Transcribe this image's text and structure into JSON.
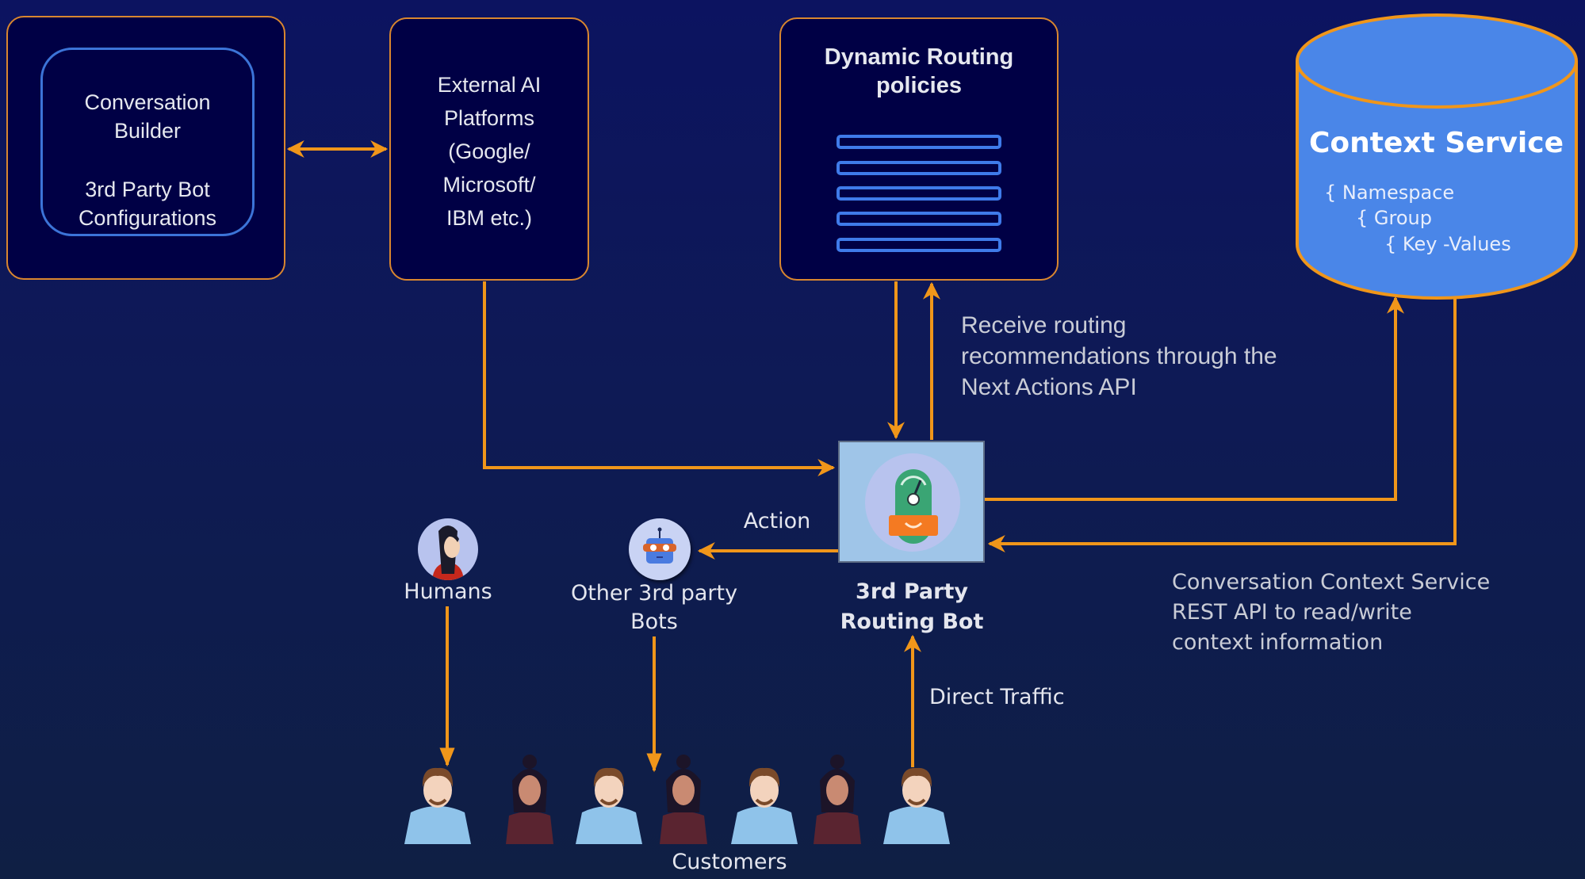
{
  "colors": {
    "background_top": "#0c1360",
    "background_bottom": "#0f1f44",
    "box_fill": "#000045",
    "box_border": "#d9862f",
    "arrow": "#f0961a",
    "accent_blue": "#3f7bea",
    "cylinder_fill": "#4a86e8",
    "routing_bot_fill": "#9fc5e8"
  },
  "boxes": {
    "conversation_builder": {
      "title_lines": [
        "Conversation",
        "Builder"
      ],
      "subtitle_lines": [
        "3rd Party Bot",
        "Configurations"
      ]
    },
    "external_ai": {
      "lines": [
        "External AI",
        "Platforms",
        "(Google/",
        "Microsoft/",
        "IBM etc.)"
      ]
    },
    "dynamic_routing": {
      "title_lines": [
        "Dynamic Routing",
        "policies"
      ],
      "policy_rows": 5
    },
    "context_service": {
      "title": "Context Service",
      "hierarchy": [
        "{ Namespace",
        "{ Group",
        "{ Key -Values"
      ]
    }
  },
  "nodes": {
    "routing_bot": {
      "label_lines": [
        "3rd Party",
        "Routing Bot"
      ],
      "icon": "routing-bot-icon"
    },
    "humans": {
      "label": "Humans",
      "icon": "human-agent-avatar-icon"
    },
    "other_bots": {
      "label_lines": [
        "Other 3rd party",
        "Bots"
      ],
      "icon": "robot-avatar-icon"
    },
    "customers": {
      "label": "Customers",
      "figures": [
        "man",
        "woman",
        "man",
        "woman",
        "man",
        "woman",
        "man"
      ]
    }
  },
  "annotations": {
    "next_actions": [
      "Receive routing",
      "recommendations through the",
      "Next Actions API"
    ],
    "context_api": [
      "Conversation Context Service",
      "REST API to read/write",
      "context information"
    ],
    "action": "Action",
    "direct_traffic": "Direct Traffic"
  }
}
